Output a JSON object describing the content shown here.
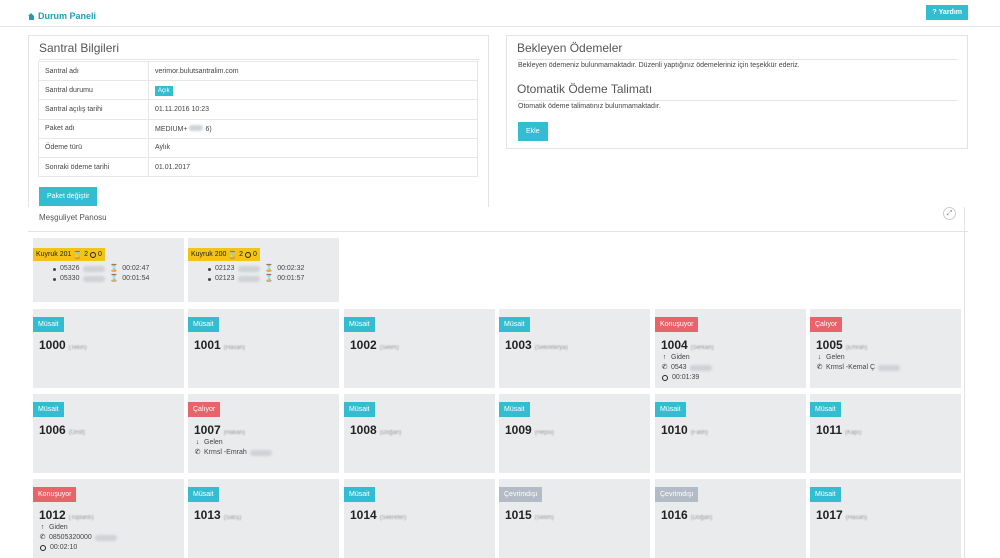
{
  "header": {
    "title": "Durum Paneli",
    "help_label": "Yardım"
  },
  "santral": {
    "title": "Santral Bilgileri",
    "rows": [
      {
        "key": "Santral adı",
        "value": "verimor.bulutsantralim.com"
      },
      {
        "key": "Santral durumu",
        "value": "Açık"
      },
      {
        "key": "Santral açılış tarihi",
        "value": "01.11.2016 10:23"
      },
      {
        "key": "Paket adı",
        "value": "MEDIUM+",
        "suffix": "6)"
      },
      {
        "key": "Ödeme türü",
        "value": "Aylık"
      },
      {
        "key": "Sonraki ödeme tarihi",
        "value": "01.01.2017"
      }
    ],
    "button_label": "Paket değiştir"
  },
  "payments": {
    "title": "Bekleyen Ödemeler",
    "text": "Bekleyen ödemeniz bulunmamaktadır. Düzenli yaptığınız ödemeleriniz için teşekkür ederiz.",
    "auto_title": "Otomatik Ödeme Talimatı",
    "auto_text": "Otomatik ödeme talimatınız bulunmamaktadır.",
    "add_label": "Ekle"
  },
  "board": {
    "title": "Meşguliyet Panosu",
    "queues": [
      {
        "name": "Kuyruk 201",
        "waiting": "2",
        "count": "0",
        "calls": [
          {
            "number": "05326",
            "time": "00:02:47"
          },
          {
            "number": "05330",
            "time": "00:01:54"
          }
        ]
      },
      {
        "name": "Kuyruk 200",
        "waiting": "2",
        "count": "0",
        "calls": [
          {
            "number": "02123",
            "time": "00:02:32"
          },
          {
            "number": "02123",
            "time": "00:01:57"
          }
        ]
      }
    ],
    "extensions": [
      {
        "status": "Müsait",
        "color": "#33bdd1",
        "number": "1000",
        "name": "(Tekin)"
      },
      {
        "status": "Müsait",
        "color": "#33bdd1",
        "number": "1001",
        "name": "(Hasan)"
      },
      {
        "status": "Müsait",
        "color": "#33bdd1",
        "number": "1002",
        "name": "(Selim)"
      },
      {
        "status": "Müsait",
        "color": "#33bdd1",
        "number": "1003",
        "name": "(Sekreterya)"
      },
      {
        "status": "Konuşuyor",
        "color": "#e8636a",
        "number": "1004",
        "name": "(Serkan)",
        "dir_icon": "arrow-up-icon",
        "dir": "Giden",
        "peer": "0543",
        "duration": "00:01:39"
      },
      {
        "status": "Çalıyor",
        "color": "#e8636a",
        "number": "1005",
        "name": "(Emrah)",
        "dir_icon": "arrow-down-icon",
        "dir": "Gelen",
        "peer": "Krmsl -Kemal Ç"
      },
      {
        "status": "Müsait",
        "color": "#33bdd1",
        "number": "1006",
        "name": "(Ümit)"
      },
      {
        "status": "Çalıyor",
        "color": "#e8636a",
        "number": "1007",
        "name": "(Hakan)",
        "dir_icon": "arrow-down-icon",
        "dir": "Gelen",
        "peer": "Krmsl -Emrah"
      },
      {
        "status": "Müsait",
        "color": "#33bdd1",
        "number": "1008",
        "name": "(Doğan)"
      },
      {
        "status": "Müsait",
        "color": "#33bdd1",
        "number": "1009",
        "name": "(Hepsi)"
      },
      {
        "status": "Müsait",
        "color": "#33bdd1",
        "number": "1010",
        "name": "(Fatih)"
      },
      {
        "status": "Müsait",
        "color": "#33bdd1",
        "number": "1011",
        "name": "(Kapı)"
      },
      {
        "status": "Konuşuyor",
        "color": "#e8636a",
        "number": "1012",
        "name": "(Toplantı)",
        "dir_icon": "arrow-up-icon",
        "dir": "Giden",
        "peer": "08505320000",
        "duration": "00:02:10"
      },
      {
        "status": "Müsait",
        "color": "#33bdd1",
        "number": "1013",
        "name": "(Satış)"
      },
      {
        "status": "Müsait",
        "color": "#33bdd1",
        "number": "1014",
        "name": "(Sekreter)"
      },
      {
        "status": "Çevrimdışı",
        "color": "#b3bcc6",
        "number": "1015",
        "name": "(Selim)"
      },
      {
        "status": "Çevrimdışı",
        "color": "#b3bcc6",
        "number": "1016",
        "name": "(Doğan)"
      },
      {
        "status": "Müsait",
        "color": "#33bdd1",
        "number": "1017",
        "name": "(Hasan)"
      }
    ]
  }
}
